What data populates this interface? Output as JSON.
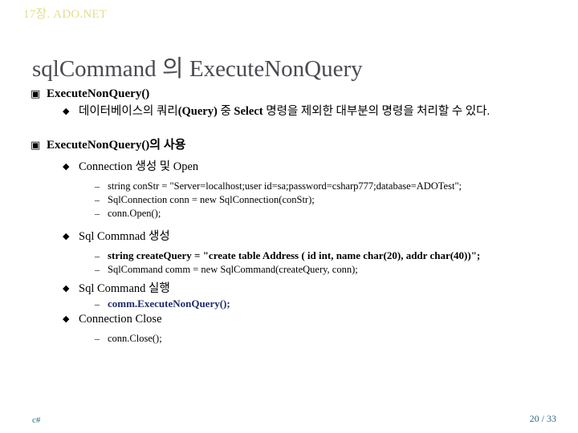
{
  "header": {
    "chapter_label": "17장. ADO.NET",
    "color": "#e5dc8e"
  },
  "title": {
    "text": "sqlCommand 의 ExecuteNonQuery",
    "color": "#4a4a52"
  },
  "bullets": {
    "section1": {
      "marker": "▣",
      "heading": "ExecuteNonQuery()",
      "sub_marker": "◆",
      "sub_item_1": "데이터베이스의 쿼리",
      "sub_item_1_bold_a": "(Query)",
      "sub_item_1_mid": " 중 ",
      "sub_item_1_bold_b": "Select",
      "sub_item_1_tail": " 명령을 제외한 대부분의 명령을 처리할 수 있다."
    },
    "section2": {
      "marker": "▣",
      "heading": "ExecuteNonQuery()의 사용",
      "sub_marker": "◆",
      "dash_marker": "–",
      "group1": {
        "label": "Connection 생성 및 Open",
        "lines": [
          "string conStr = \"Server=localhost;user id=sa;password=csharp777;database=ADOTest\";",
          "SqlConnection conn = new SqlConnection(conStr);",
          "conn.Open();"
        ]
      },
      "group2": {
        "label": "Sql Commnad 생성",
        "line_bold": "string createQuery = \"create table Address ( id int, name char(20), addr char(40))\";",
        "line_plain": "SqlCommand comm = new SqlCommand(createQuery, conn);"
      },
      "group3": {
        "label": "Sql Command 실행",
        "line_accent": "comm.ExecuteNonQuery();",
        "accent_color": "#1f2d6b"
      },
      "group4": {
        "label": "Connection Close",
        "line_plain": "conn.Close();"
      }
    }
  },
  "footer": {
    "left_label": "c#",
    "page_indicator": "20 / 33",
    "color": "#2b6b86"
  }
}
